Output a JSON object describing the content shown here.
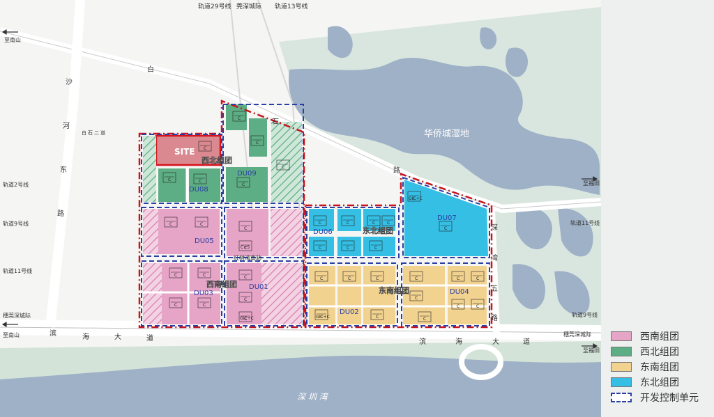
{
  "map": {
    "rail_labels_top": [
      "轨道29号线",
      "莞深城际",
      "轨道13号线"
    ],
    "road_baishi": [
      "白",
      "石",
      "路"
    ],
    "road_shahedong": [
      "沙",
      "河",
      "东",
      "路"
    ],
    "road_binhai_left": [
      "滨",
      "海",
      "大",
      "道"
    ],
    "road_binhai_right": [
      "滨",
      "海",
      "大",
      "道"
    ],
    "road_shenwan5": [
      "深",
      "湾",
      "五",
      "路"
    ],
    "baishi2": "白石二道",
    "to_nanshan": "至南山",
    "to_futian": "至福田",
    "left_rail": [
      "轨道2号线",
      "轨道9号线",
      "轨道11号线",
      "穗莞深城际",
      "至南山"
    ],
    "right_rail": [
      "轨道11号线",
      "轨道9号线",
      "穗莞深城际",
      "至福田"
    ],
    "wetland": "华侨城湿地",
    "bay": "深 圳 湾",
    "station": "红树湾南站",
    "site": "SITE",
    "groups": {
      "nw": "西北组团",
      "ne": "东北组团",
      "sw": "西南组团",
      "se": "东南组团"
    },
    "units": {
      "du01": "DU01",
      "du02": "DU02",
      "du03": "DU03",
      "du04": "DU04",
      "du05": "DU05",
      "du06": "DU06",
      "du07": "DU07",
      "du08": "DU08",
      "du09": "DU09"
    },
    "plot_label": "C",
    "plot_special": [
      "C+S",
      "GIC+C",
      "GIC+C",
      "GIC+C"
    ]
  },
  "legend": {
    "items": [
      {
        "label": "西南组团",
        "color": "#e6a4c7"
      },
      {
        "label": "西北组团",
        "color": "#5dae84"
      },
      {
        "label": "东南组团",
        "color": "#f2d28f"
      },
      {
        "label": "东北组团",
        "color": "#35bfe4"
      }
    ],
    "boundary_label": "开发控制单元",
    "boundary_color": "#2b3fa3"
  },
  "colors": {
    "water": "#9fb1c7",
    "land": "#d7e3de",
    "road": "#ffffff",
    "redline": "#c8141c"
  }
}
